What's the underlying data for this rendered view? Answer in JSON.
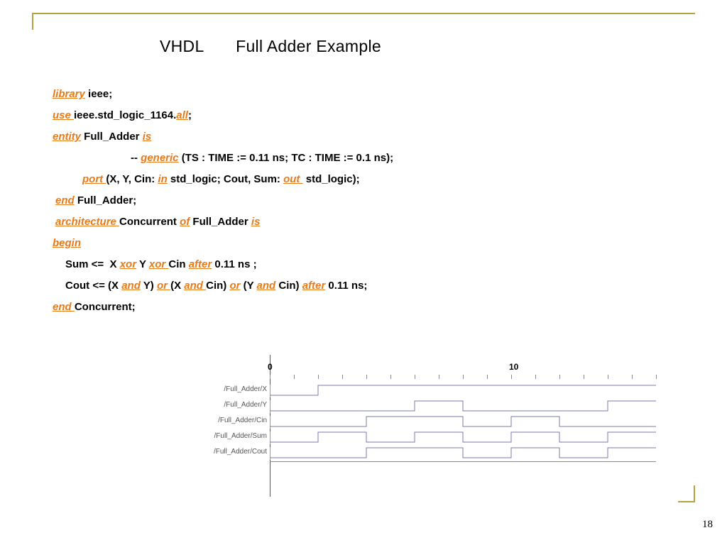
{
  "title": {
    "part1": "VHDL",
    "part2": "Full Adder Example"
  },
  "page_number": "18",
  "code": {
    "lines": [
      [
        {
          "kw": "library"
        },
        {
          "t": " ieee;"
        }
      ],
      [
        {
          "kw": "use "
        },
        {
          "t": "ieee.std_logic_1164."
        },
        {
          "kw": "all"
        },
        {
          "t": ";"
        }
      ],
      [
        {
          "kw": "entity"
        },
        {
          "t": " Full_Adder "
        },
        {
          "kw": "is"
        }
      ],
      [
        {
          "t": "-- "
        },
        {
          "kw": "generic"
        },
        {
          "t": " (TS : TIME := 0.11 ns; TC : TIME := 0.1 ns);"
        }
      ],
      [
        {
          "kw": "port "
        },
        {
          "t": "(X, Y, Cin: "
        },
        {
          "kw": "in"
        },
        {
          "t": " std_logic; Cout, Sum: "
        },
        {
          "kw": "out "
        },
        {
          "t": " std_logic);"
        }
      ],
      [
        {
          "kw": "end"
        },
        {
          "t": " Full_Adder;"
        }
      ],
      [
        {
          "kw": "architecture "
        },
        {
          "t": "Concurrent "
        },
        {
          "kw": "of"
        },
        {
          "t": " Full_Adder "
        },
        {
          "kw": "is"
        }
      ],
      [
        {
          "kw": "begin"
        }
      ],
      [
        {
          "t": "Sum <=  X "
        },
        {
          "kw": "xor"
        },
        {
          "t": " Y "
        },
        {
          "kw": "xor "
        },
        {
          "t": "Cin "
        },
        {
          "kw": "after"
        },
        {
          "t": " 0.11 ns ;"
        }
      ],
      [
        {
          "t": "Cout <= (X "
        },
        {
          "kw": "and"
        },
        {
          "t": " Y) "
        },
        {
          "kw": "or "
        },
        {
          "t": "(X "
        },
        {
          "kw": "and "
        },
        {
          "t": "Cin) "
        },
        {
          "kw": "or"
        },
        {
          "t": " (Y "
        },
        {
          "kw": "and"
        },
        {
          "t": " Cin) "
        },
        {
          "kw": "after"
        },
        {
          "t": " 0.11 ns;"
        }
      ],
      [
        {
          "kw": "end "
        },
        {
          "t": "Concurrent;"
        }
      ]
    ],
    "indents": [
      "",
      "",
      "",
      "in2",
      "in1",
      "in4",
      "in4",
      "",
      "in3",
      "in3",
      ""
    ]
  },
  "chart_data": {
    "type": "timing",
    "title": "",
    "x_ticks": [
      0,
      10
    ],
    "x_minor_step": 1,
    "x_range": [
      0,
      16
    ],
    "signals": [
      {
        "name": "/Full_Adder/X",
        "levels": [
          {
            "t": 0,
            "v": 0
          },
          {
            "t": 2,
            "v": 1
          },
          {
            "t": 16,
            "v": 1
          }
        ]
      },
      {
        "name": "/Full_Adder/Y",
        "levels": [
          {
            "t": 0,
            "v": 0
          },
          {
            "t": 6,
            "v": 1
          },
          {
            "t": 8,
            "v": 0
          },
          {
            "t": 14,
            "v": 1
          },
          {
            "t": 16,
            "v": 1
          }
        ]
      },
      {
        "name": "/Full_Adder/Cin",
        "levels": [
          {
            "t": 0,
            "v": 0
          },
          {
            "t": 4,
            "v": 1
          },
          {
            "t": 8,
            "v": 0
          },
          {
            "t": 10,
            "v": 1
          },
          {
            "t": 12,
            "v": 0
          },
          {
            "t": 16,
            "v": 0
          }
        ]
      },
      {
        "name": "/Full_Adder/Sum",
        "levels": [
          {
            "t": 0,
            "v": 0
          },
          {
            "t": 2,
            "v": 1
          },
          {
            "t": 4,
            "v": 0
          },
          {
            "t": 6,
            "v": 1
          },
          {
            "t": 8,
            "v": 0
          },
          {
            "t": 10,
            "v": 1
          },
          {
            "t": 12,
            "v": 0
          },
          {
            "t": 14,
            "v": 1
          },
          {
            "t": 16,
            "v": 1
          }
        ]
      },
      {
        "name": "/Full_Adder/Cout",
        "levels": [
          {
            "t": 0,
            "v": 0
          },
          {
            "t": 4,
            "v": 1
          },
          {
            "t": 8,
            "v": 0
          },
          {
            "t": 10,
            "v": 1
          },
          {
            "t": 12,
            "v": 0
          },
          {
            "t": 14,
            "v": 1
          },
          {
            "t": 16,
            "v": 1
          }
        ]
      }
    ]
  }
}
